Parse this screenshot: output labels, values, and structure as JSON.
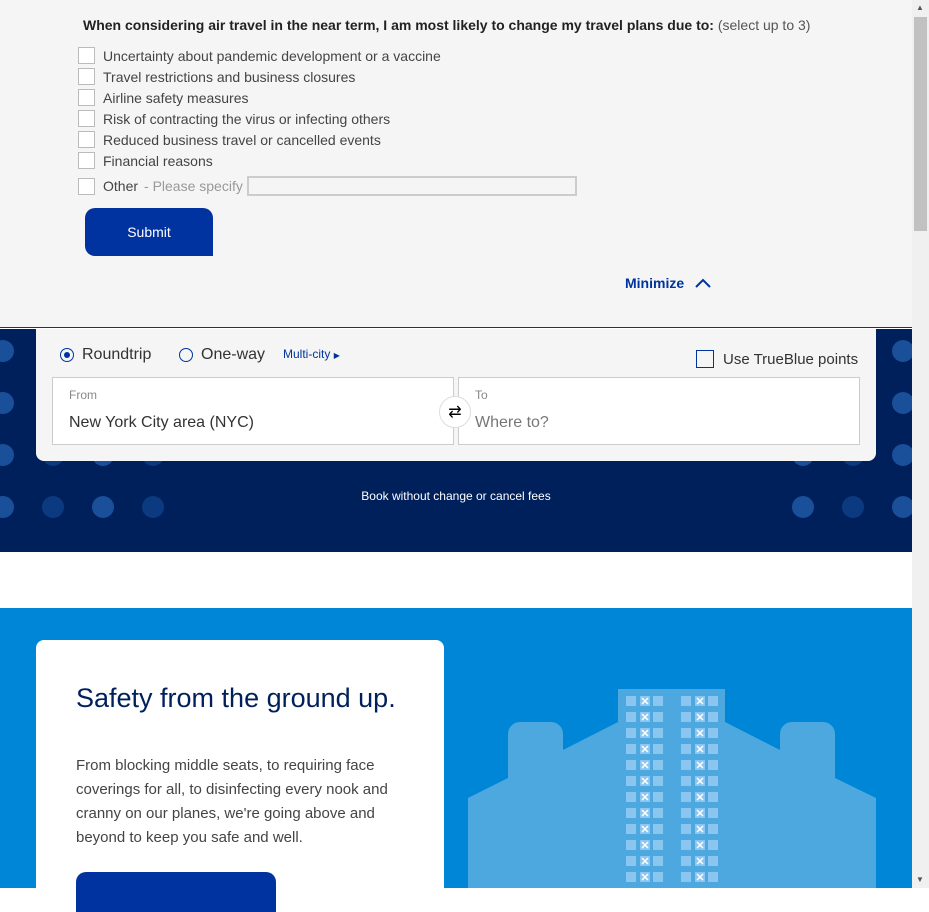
{
  "survey": {
    "question": "When considering air travel in the near term, I am most likely to change my travel plans due to:",
    "hint": "(select up to 3)",
    "options": [
      "Uncertainty about pandemic development or a vaccine",
      "Travel restrictions and business closures",
      "Airline safety measures",
      "Risk of contracting the virus or infecting others",
      "Reduced business travel or cancelled events",
      "Financial reasons",
      "Other"
    ],
    "other_placeholder": "- Please specify",
    "other_value": "",
    "submit": "Submit",
    "minimize": "Minimize"
  },
  "booking": {
    "roundtrip": "Roundtrip",
    "oneway": "One-way",
    "multicity": "Multi-city",
    "trip_type": "Roundtrip",
    "truebluelabel": "Use TrueBlue points",
    "from_label": "From",
    "from_value": "New York City area (NYC)",
    "to_label": "To",
    "to_placeholder": "Where to?",
    "fees": "Book without change or cancel fees"
  },
  "safety": {
    "title": "Safety from the ground up.",
    "body": "From blocking middle seats, to requiring face coverings for all, to disinfecting every nook and cranny on our planes, we're going above and beyond to keep you safe and well."
  },
  "colors": {
    "brand": "#0033a0",
    "navy": "#00205b",
    "sky": "#0086d6"
  }
}
